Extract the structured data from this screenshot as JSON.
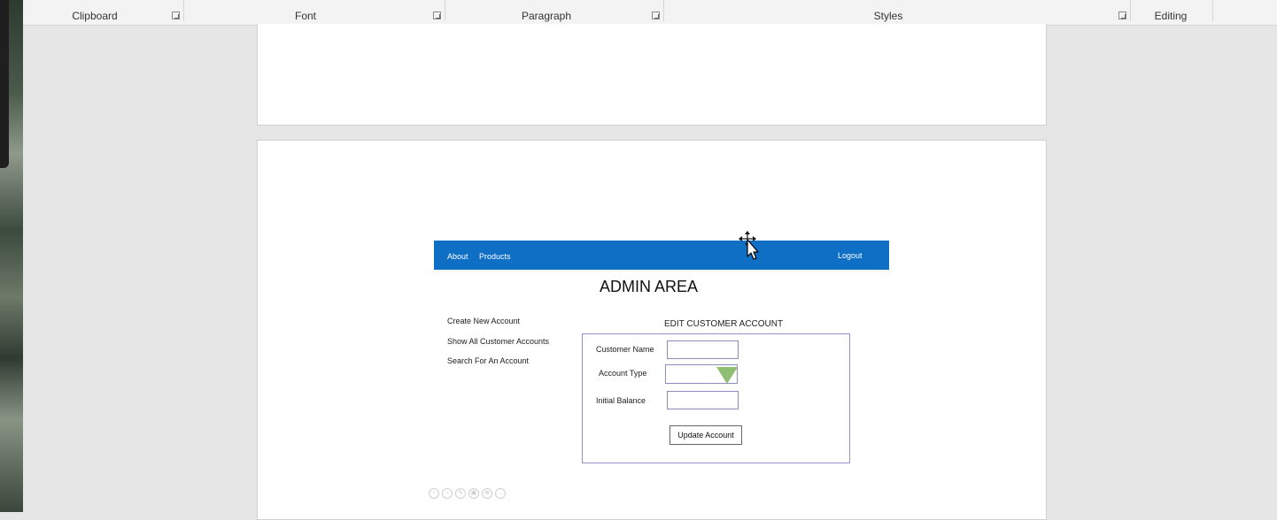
{
  "ribbon": {
    "groups": [
      {
        "label": "Clipboard"
      },
      {
        "label": "Font"
      },
      {
        "label": "Paragraph"
      },
      {
        "label": "Styles"
      },
      {
        "label": "Editing"
      }
    ]
  },
  "mockup": {
    "nav": {
      "about": "About",
      "products": "Products",
      "logout": "Logout"
    },
    "title": "ADMIN AREA",
    "side_links": [
      "Create New Account",
      "Show All Customer Accounts",
      "Search For An Account"
    ],
    "form": {
      "title": "EDIT CUSTOMER ACCOUNT",
      "customer_name_label": "Customer Name",
      "account_type_label": "Account Type",
      "initial_balance_label": "Initial Balance",
      "customer_name_value": "",
      "initial_balance_value": "",
      "submit_label": "Update Account",
      "dropdown_color": "#8fbf72"
    },
    "nav_color": "#0e6fc5"
  },
  "toolbar_icons": [
    "previous-icon",
    "next-icon",
    "edit-icon",
    "copy-icon",
    "zoom-icon",
    "more-icon"
  ]
}
